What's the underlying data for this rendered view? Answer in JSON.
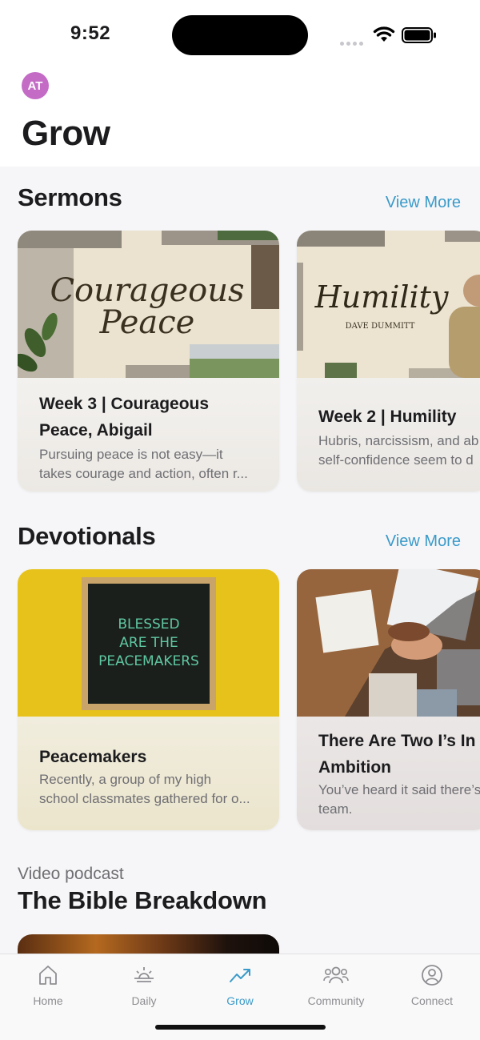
{
  "status": {
    "time": "9:52"
  },
  "header": {
    "avatar_initials": "AT",
    "title": "Grow"
  },
  "sermons": {
    "title": "Sermons",
    "view_more": "View More",
    "cards": [
      {
        "art_title_line1": "Courageous",
        "art_title_line2": "Peace",
        "title": "Week 3 |  Courageous Peace, Abigail",
        "description": "Pursuing peace is not easy—it\ntakes courage and action, often r..."
      },
      {
        "art_title_line1": "Humility",
        "art_subtitle": "DAVE DUMMITT",
        "title": "Week 2 | Humility",
        "description": "Hubris, narcissism, and ab\nself-confidence seem to d"
      }
    ]
  },
  "devotionals": {
    "title": "Devotionals",
    "view_more": "View More",
    "cards": [
      {
        "art_line1": "BLESSED",
        "art_line2": "ARE THE",
        "art_line3": "PEACEMAKERS",
        "title": "Peacemakers",
        "description": "Recently, a group of my high\nschool classmates gathered for o..."
      },
      {
        "title": "There Are Two I’s In Ambition",
        "description": "You’ve heard it said there’s\nteam."
      }
    ]
  },
  "podcast": {
    "label": "Video podcast",
    "title": "The Bible Breakdown"
  },
  "tab_bar": {
    "tabs": [
      {
        "label": "Home",
        "icon": "home-icon"
      },
      {
        "label": "Daily",
        "icon": "sunrise-icon"
      },
      {
        "label": "Grow",
        "icon": "trending-up-icon",
        "active": true
      },
      {
        "label": "Community",
        "icon": "people-icon"
      },
      {
        "label": "Connect",
        "icon": "user-circle-icon"
      }
    ]
  },
  "colors": {
    "accent": "#3a9ac9",
    "avatar": "#c46bc6"
  }
}
